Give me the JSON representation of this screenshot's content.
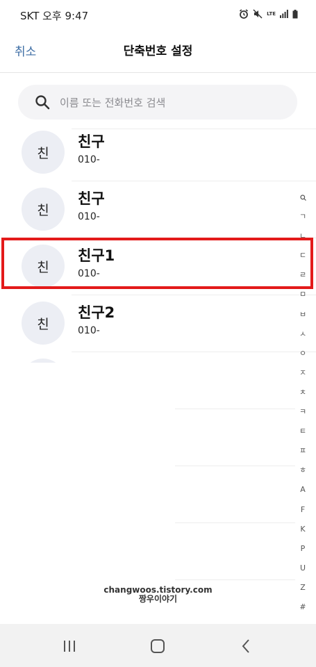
{
  "status": {
    "carrier_time": "SKT 오후 9:47",
    "lte": "LTE"
  },
  "header": {
    "cancel_label": "취소",
    "title": "단축번호 설정"
  },
  "search": {
    "placeholder": "이름 또는 전화번호 검색"
  },
  "contacts": [
    {
      "avatar": "친",
      "name": "친구",
      "number": "010-",
      "selected": false
    },
    {
      "avatar": "친",
      "name": "친구",
      "number": "010-",
      "selected": false
    },
    {
      "avatar": "친",
      "name": "친구1",
      "number": "010-",
      "selected": true
    },
    {
      "avatar": "친",
      "name": "친구2",
      "number": "010-",
      "selected": false
    }
  ],
  "index": [
    "ㄱ",
    "ㄴ",
    "ㄷ",
    "ㄹ",
    "ㅁ",
    "ㅂ",
    "ㅅ",
    "ㅇ",
    "ㅈ",
    "ㅊ",
    "ㅋ",
    "ㅌ",
    "ㅍ",
    "ㅎ",
    "A",
    "F",
    "K",
    "P",
    "U",
    "Z",
    "#"
  ],
  "watermark": {
    "line1": "changwoos.tistory.com",
    "line2": "짱우이야기"
  },
  "colors": {
    "accent": "#3e6ea5",
    "highlight": "#e31a1a"
  }
}
